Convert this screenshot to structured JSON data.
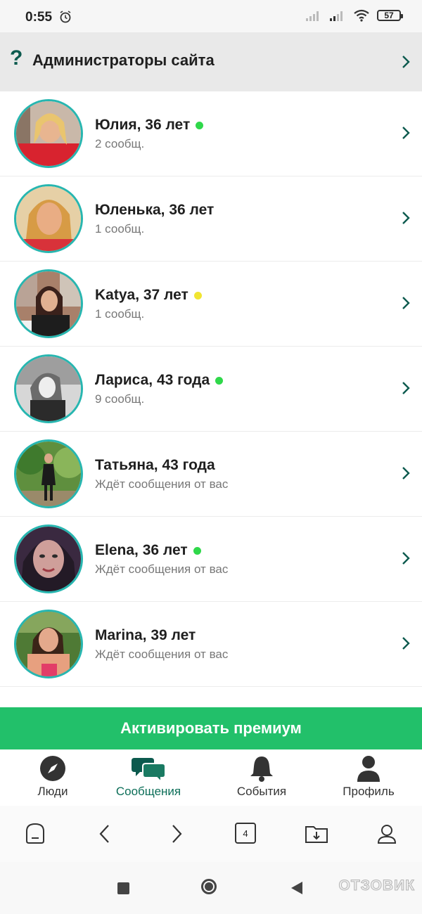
{
  "status": {
    "time": "0:55",
    "battery": "57"
  },
  "admin": {
    "label": "Администраторы сайта",
    "icon": "question-icon"
  },
  "contacts": [
    {
      "name": "Юлия, 36 лет",
      "sub": "2 сообщ.",
      "status_color": "#2fd84a"
    },
    {
      "name": "Юленька, 36 лет",
      "sub": "1 сообщ.",
      "status_color": null
    },
    {
      "name": "Katya, 37 лет",
      "sub": "1 сообщ.",
      "status_color": "#f1e531"
    },
    {
      "name": "Лариса, 43 года",
      "sub": "9 сообщ.",
      "status_color": "#2fd84a"
    },
    {
      "name": "Татьяна, 43 года",
      "sub": "Ждёт сообщения от вас",
      "status_color": null
    },
    {
      "name": "Elena, 36 лет",
      "sub": "Ждёт сообщения от вас",
      "status_color": "#2fd84a"
    },
    {
      "name": "Marina, 39 лет",
      "sub": "Ждёт сообщения от вас",
      "status_color": null
    }
  ],
  "premium_label": "Активировать премиум",
  "tabs": [
    {
      "label": "Люди",
      "icon": "compass-icon"
    },
    {
      "label": "Сообщения",
      "icon": "chat-icon"
    },
    {
      "label": "События",
      "icon": "bell-icon"
    },
    {
      "label": "Профиль",
      "icon": "user-icon"
    }
  ],
  "browser": {
    "tab_count": "4"
  },
  "watermark": "ОТЗОВИК",
  "colors": {
    "accent": "#0c5a4e",
    "premium": "#22c06a",
    "avatar_ring": "#27b6b0"
  }
}
